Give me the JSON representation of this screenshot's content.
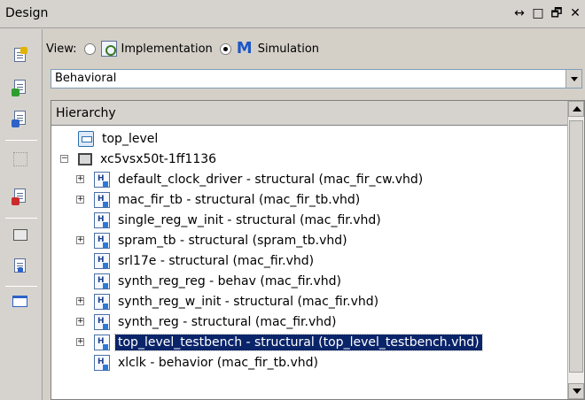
{
  "window": {
    "title": "Design",
    "controls": [
      "↔",
      "□",
      "🗗",
      "✕"
    ]
  },
  "view": {
    "label": "View:",
    "options": [
      {
        "label": "Implementation",
        "selected": false,
        "icon": "implementation-icon"
      },
      {
        "label": "Simulation",
        "selected": true,
        "icon": "simulation-icon"
      }
    ]
  },
  "config_select": {
    "value": "Behavioral"
  },
  "hierarchy": {
    "header": "Hierarchy",
    "items": [
      {
        "label": "top_level",
        "icon": "top-level-icon",
        "depth": 0,
        "expander": ""
      },
      {
        "label": "xc5vsx50t-1ff1136",
        "icon": "chip-icon",
        "depth": 0,
        "expander": "−"
      },
      {
        "label": "default_clock_driver - structural (mac_fir_cw.vhd)",
        "icon": "vhdl-file-icon",
        "depth": 1,
        "expander": "+"
      },
      {
        "label": "mac_fir_tb - structural (mac_fir_tb.vhd)",
        "icon": "vhdl-file-icon",
        "depth": 1,
        "expander": "+"
      },
      {
        "label": "single_reg_w_init - structural (mac_fir.vhd)",
        "icon": "vhdl-file-icon",
        "depth": 1,
        "expander": ""
      },
      {
        "label": "spram_tb - structural (spram_tb.vhd)",
        "icon": "vhdl-file-icon",
        "depth": 1,
        "expander": "+"
      },
      {
        "label": "srl17e - structural (mac_fir.vhd)",
        "icon": "vhdl-file-icon",
        "depth": 1,
        "expander": ""
      },
      {
        "label": "synth_reg_reg - behav (mac_fir.vhd)",
        "icon": "vhdl-file-icon",
        "depth": 1,
        "expander": ""
      },
      {
        "label": "synth_reg_w_init - structural (mac_fir.vhd)",
        "icon": "vhdl-file-icon",
        "depth": 1,
        "expander": "+"
      },
      {
        "label": "synth_reg - structural (mac_fir.vhd)",
        "icon": "vhdl-file-icon",
        "depth": 1,
        "expander": "+"
      },
      {
        "label": "top_level_testbench - structural (top_level_testbench.vhd)",
        "icon": "vhdl-file-icon",
        "depth": 1,
        "expander": "+",
        "selected": true
      },
      {
        "label": "xlclk - behavior (mac_fir_tb.vhd)",
        "icon": "vhdl-file-icon",
        "depth": 1,
        "expander": ""
      }
    ]
  },
  "toolbar_icons": [
    "new-source-icon",
    "add-source-icon",
    "add-copy-icon",
    "hierarchy-icon",
    "remove-icon",
    "properties-icon",
    "edit-icon",
    "panel-icon"
  ],
  "colors": {
    "selection": "#0a246a",
    "panel_bg": "#d6d3ce"
  }
}
